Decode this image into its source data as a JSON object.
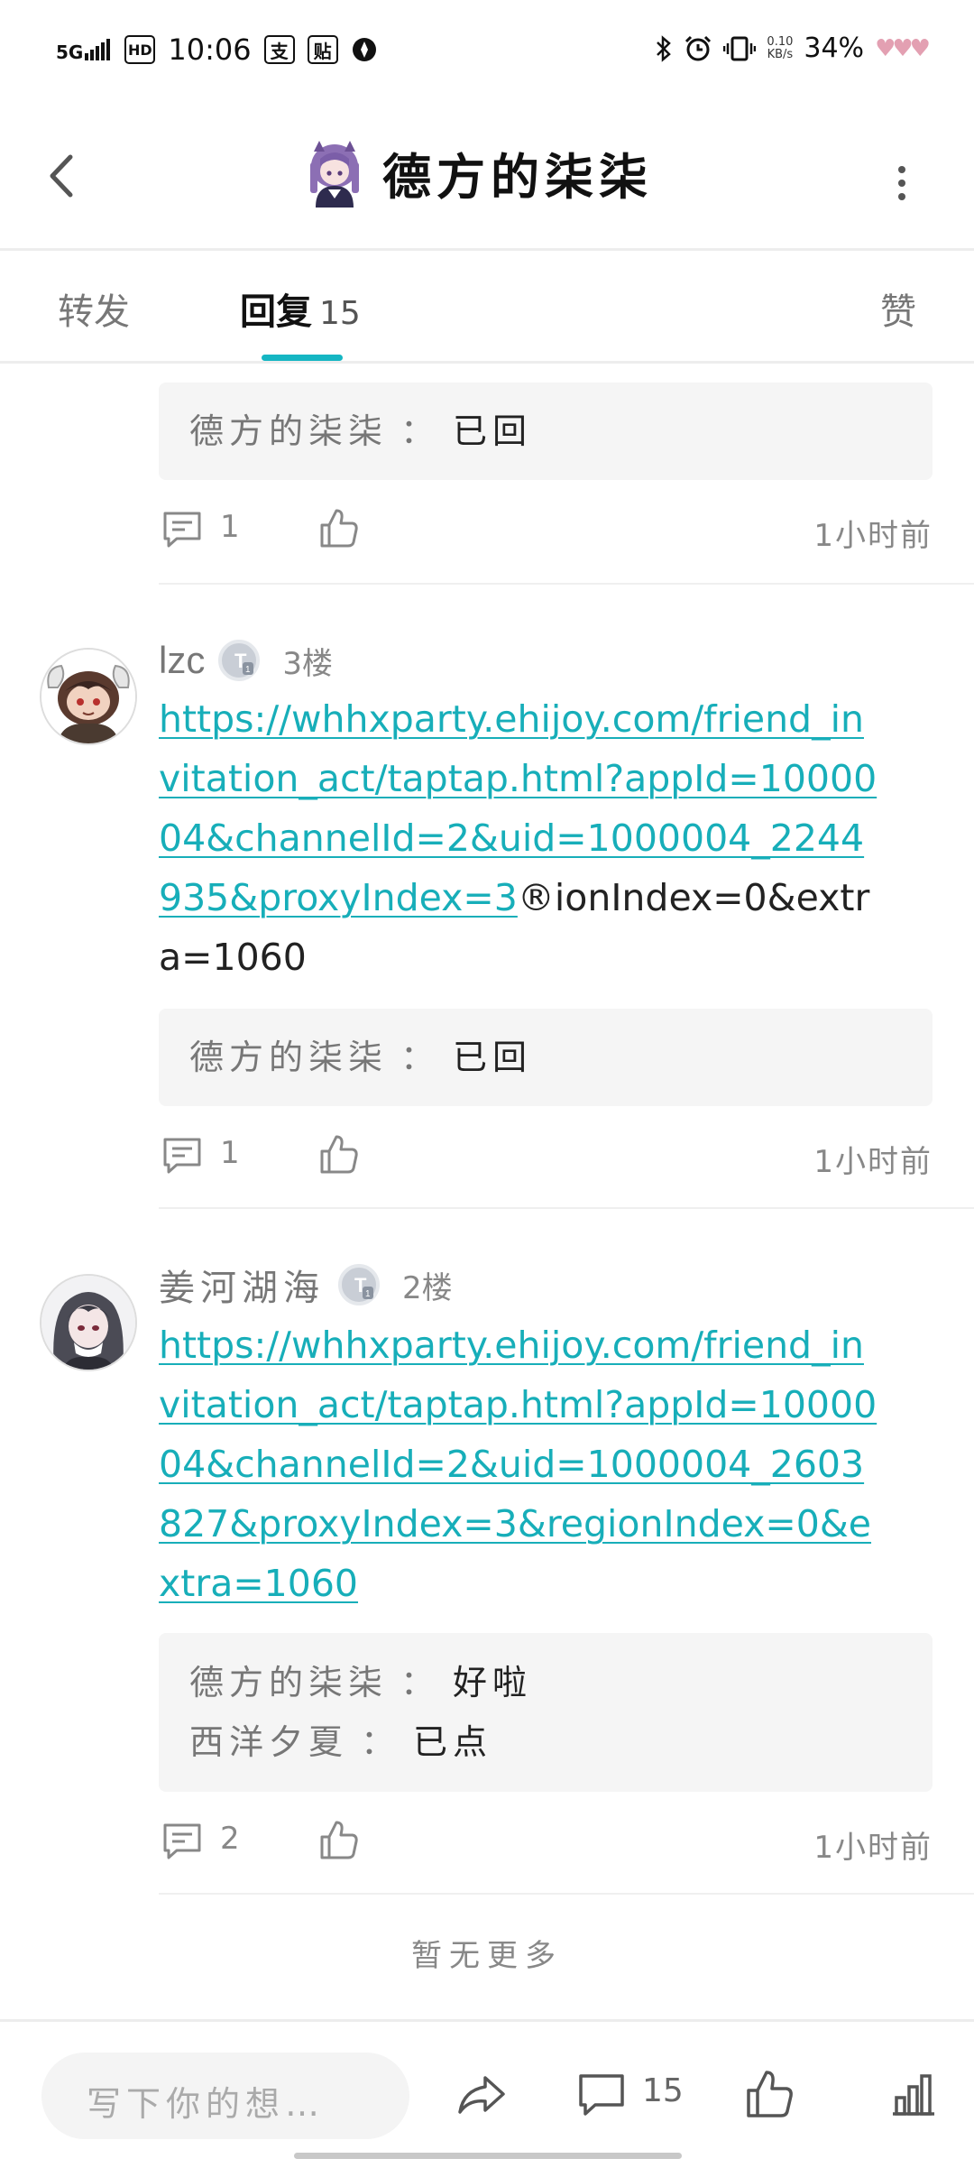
{
  "status_bar": {
    "network": "5G",
    "hd": "HD",
    "time": "10:06",
    "icon_pay": "支",
    "icon_paste": "贴",
    "speed_value": "0.10",
    "speed_unit": "KB/s",
    "battery": "34%"
  },
  "nav": {
    "title": "德方的柒柒"
  },
  "tabs": {
    "forward": "转发",
    "reply": "回复",
    "reply_count": "15",
    "like": "赞"
  },
  "replies": [
    {
      "sub_replies": [
        {
          "name": "德方的柒柒",
          "sep": "：",
          "text": "已回"
        }
      ],
      "comment_count": "1",
      "time": "1小时前"
    },
    {
      "user": "lzc",
      "floor": "3楼",
      "link_text": "https://whhxparty.ehijoy.com/friend_invitation_act/taptap.html?appId=1000004&channelId=2&uid=1000004_2244935&proxyIndex=3",
      "plain_text": "®ionIndex=0&extra=1060",
      "sub_replies": [
        {
          "name": "德方的柒柒",
          "sep": "：",
          "text": "已回"
        }
      ],
      "comment_count": "1",
      "time": "1小时前"
    },
    {
      "user": "姜河湖海",
      "floor": "2楼",
      "link_text": "https://whhxparty.ehijoy.com/friend_invitation_act/taptap.html?appId=1000004&channelId=2&uid=1000004_2603827&proxyIndex=3&regionIndex=0&extra=1060",
      "sub_replies": [
        {
          "name": "德方的柒柒",
          "sep": "：",
          "text": "好啦"
        },
        {
          "name": "西洋夕夏",
          "sep": "：",
          "text": "已点"
        }
      ],
      "comment_count": "2",
      "time": "1小时前"
    }
  ],
  "footer": {
    "no_more": "暂无更多"
  },
  "bottom_bar": {
    "compose_placeholder": "写下你的想…",
    "comment_count": "15"
  },
  "colors": {
    "accent": "#15b6c3",
    "link": "#17aeb9",
    "sub_box_bg": "#f5f5f5",
    "hearts": "#e3a0b2"
  }
}
